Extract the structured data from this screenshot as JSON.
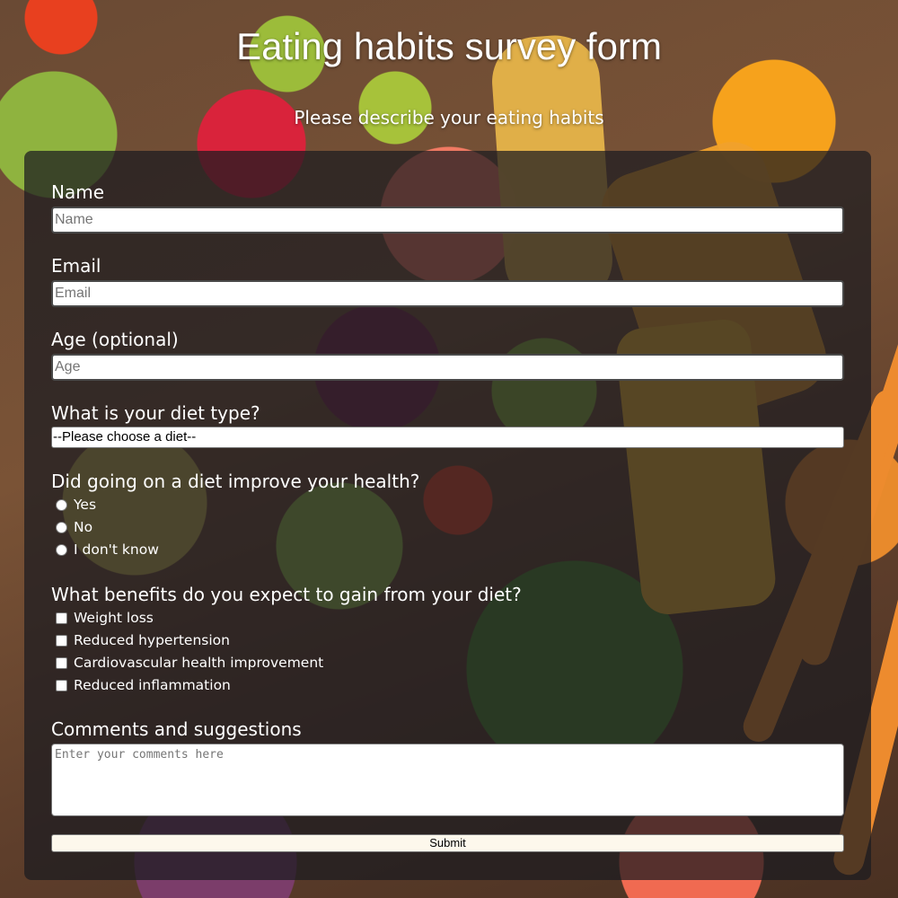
{
  "page": {
    "title": "Eating habits survey form",
    "description": "Please describe your eating habits"
  },
  "form": {
    "name": {
      "label": "Name",
      "placeholder": "Name"
    },
    "email": {
      "label": "Email",
      "placeholder": "Email"
    },
    "age": {
      "label": "Age (optional)",
      "placeholder": "Age"
    },
    "diet_type": {
      "label": "What is your diet type?",
      "selected": "--Please choose a diet--"
    },
    "health_question": {
      "label": "Did going on a diet improve your health?",
      "options": [
        "Yes",
        "No",
        "I don't know"
      ]
    },
    "benefits_question": {
      "label": "What benefits do you expect to gain from your diet?",
      "options": [
        "Weight loss",
        "Reduced hypertension",
        "Cardiovascular health improvement",
        "Reduced inflammation"
      ]
    },
    "comments": {
      "label": "Comments and suggestions",
      "placeholder": "Enter your comments here"
    },
    "submit_label": "Submit"
  }
}
